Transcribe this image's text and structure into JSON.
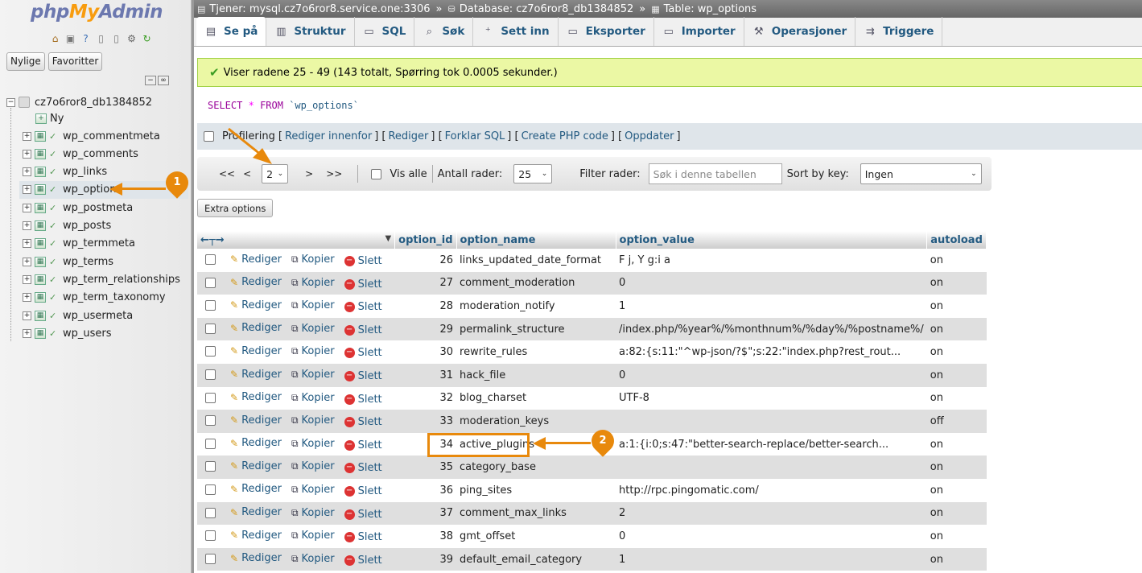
{
  "logo": {
    "php": "php",
    "my": "My",
    "admin": "Admin"
  },
  "nav": {
    "buttons": [
      "Nylige",
      "Favoritter"
    ],
    "database": "cz7o6ror8_db1384852",
    "new_label": "Ny",
    "tables": [
      "wp_commentmeta",
      "wp_comments",
      "wp_links",
      "wp_options",
      "wp_postmeta",
      "wp_posts",
      "wp_termmeta",
      "wp_terms",
      "wp_term_relationships",
      "wp_term_taxonomy",
      "wp_usermeta",
      "wp_users"
    ],
    "active_table": "wp_options"
  },
  "breadcrumb": {
    "server": "Tjener: mysql.cz7o6ror8.service.one:3306",
    "database": "Database: cz7o6ror8_db1384852",
    "table": "Table: wp_options"
  },
  "tabs": [
    "Se på",
    "Struktur",
    "SQL",
    "Søk",
    "Sett inn",
    "Eksporter",
    "Importer",
    "Operasjoner",
    "Triggere"
  ],
  "message": "Viser radene 25 - 49 (143 totalt, Spørring tok 0.0005 sekunder.)",
  "sql": {
    "select": "SELECT",
    "star": "*",
    "from": "FROM",
    "table": "`wp_options`"
  },
  "sql_links": {
    "profiling": "Profilering",
    "edit_inline": "Rediger innenfor",
    "edit": "Rediger",
    "explain": "Forklar SQL",
    "php": "Create PHP code",
    "refresh": "Oppdater"
  },
  "pager": {
    "first": "<<",
    "prev": "<",
    "page": "2",
    "next": ">",
    "last": ">>",
    "show_all": "Vis alle",
    "rows_label": "Antall rader:",
    "rows_value": "25",
    "filter_label": "Filter rader:",
    "filter_placeholder": "Søk i denne tabellen",
    "sort_label": "Sort by key:",
    "sort_value": "Ingen"
  },
  "extra_options": "Extra options",
  "columns": [
    "option_id",
    "option_name",
    "option_value",
    "autoload"
  ],
  "actions": {
    "edit": "Rediger",
    "copy": "Kopier",
    "delete": "Slett"
  },
  "rows": [
    {
      "id": "26",
      "name": "links_updated_date_format",
      "value": "F j, Y g:i a",
      "autoload": "on"
    },
    {
      "id": "27",
      "name": "comment_moderation",
      "value": "0",
      "autoload": "on"
    },
    {
      "id": "28",
      "name": "moderation_notify",
      "value": "1",
      "autoload": "on"
    },
    {
      "id": "29",
      "name": "permalink_structure",
      "value": "/index.php/%year%/%monthnum%/%day%/%postname%/",
      "autoload": "on"
    },
    {
      "id": "30",
      "name": "rewrite_rules",
      "value": "a:82:{s:11:\"^wp-json/?$\";s:22:\"index.php?rest_rout...",
      "autoload": "on"
    },
    {
      "id": "31",
      "name": "hack_file",
      "value": "0",
      "autoload": "on"
    },
    {
      "id": "32",
      "name": "blog_charset",
      "value": "UTF-8",
      "autoload": "on"
    },
    {
      "id": "33",
      "name": "moderation_keys",
      "value": "",
      "autoload": "off"
    },
    {
      "id": "34",
      "name": "active_plugins",
      "value": "a:1:{i:0;s:47:\"better-search-replace/better-search...",
      "autoload": "on"
    },
    {
      "id": "35",
      "name": "category_base",
      "value": "",
      "autoload": "on"
    },
    {
      "id": "36",
      "name": "ping_sites",
      "value": "http://rpc.pingomatic.com/",
      "autoload": "on"
    },
    {
      "id": "37",
      "name": "comment_max_links",
      "value": "2",
      "autoload": "on"
    },
    {
      "id": "38",
      "name": "gmt_offset",
      "value": "0",
      "autoload": "on"
    },
    {
      "id": "39",
      "name": "default_email_category",
      "value": "1",
      "autoload": "on"
    }
  ],
  "annotations": {
    "badge1": "1",
    "badge2": "2"
  },
  "colors": {
    "accent": "#e8890c",
    "link": "#235a81",
    "success_bg": "#ebf8a4"
  }
}
